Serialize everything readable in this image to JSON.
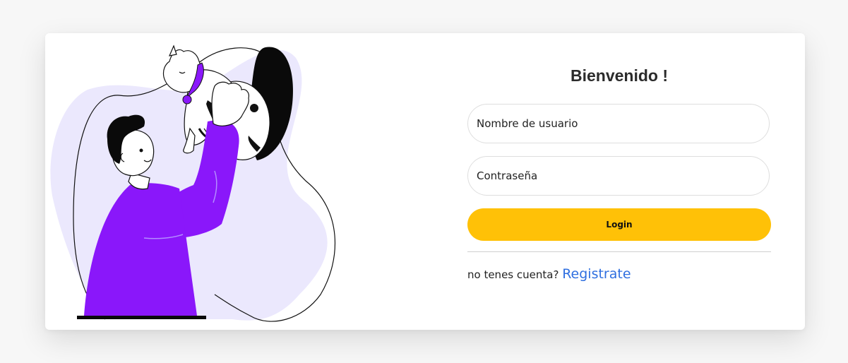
{
  "login": {
    "title": "Bienvenido !",
    "username_placeholder": "Nombre de usuario",
    "password_placeholder": "Contraseña",
    "login_label": "Login",
    "register_prompt": "no tenes cuenta?",
    "register_link": "Registrate"
  },
  "colors": {
    "accent_purple": "#8a17fa",
    "blob_lavender": "#ebe8fd",
    "button_yellow": "#ffc107",
    "link_blue": "#2f6fe0"
  }
}
